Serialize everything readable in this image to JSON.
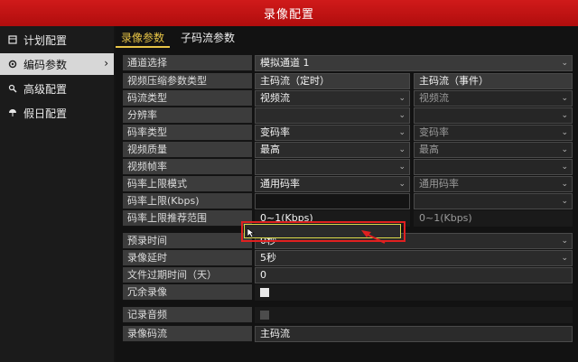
{
  "window": {
    "title": "录像配置"
  },
  "sidebar": {
    "items": [
      {
        "label": "计划配置",
        "icon": "calendar-icon"
      },
      {
        "label": "编码参数",
        "icon": "gear-icon",
        "active": true
      },
      {
        "label": "高级配置",
        "icon": "wrench-icon"
      },
      {
        "label": "假日配置",
        "icon": "umbrella-icon"
      }
    ]
  },
  "tabs": [
    {
      "label": "录像参数",
      "active": true
    },
    {
      "label": "子码流参数"
    }
  ],
  "form": {
    "channel": {
      "label": "通道选择",
      "value": "模拟通道 1"
    },
    "compression_type": {
      "label": "视频压缩参数类型",
      "main": "主码流（定时）",
      "event": "主码流（事件）"
    },
    "stream_type": {
      "label": "码流类型",
      "main": "视频流",
      "event": "视频流"
    },
    "resolution": {
      "label": "分辨率",
      "main": "",
      "event": ""
    },
    "bitrate_type": {
      "label": "码率类型",
      "main": "变码率",
      "event": "变码率"
    },
    "video_quality": {
      "label": "视频质量",
      "main": "最高",
      "event": "最高"
    },
    "frame_rate": {
      "label": "视频帧率",
      "main": "",
      "event": ""
    },
    "bitrate_limit_mode": {
      "label": "码率上限模式",
      "main": "通用码率",
      "event": "通用码率"
    },
    "bitrate_limit": {
      "label": "码率上限(Kbps)",
      "main": "",
      "event": ""
    },
    "bitrate_recommended": {
      "label": "码率上限推荐范围",
      "main": "0~1(Kbps)",
      "event": "0~1(Kbps)"
    },
    "pre_record": {
      "label": "预录时间",
      "value": "0秒"
    },
    "post_record": {
      "label": "录像延时",
      "value": "5秒"
    },
    "expire_days": {
      "label": "文件过期时间（天）",
      "value": "0"
    },
    "redundant": {
      "label": "冗余录像"
    },
    "audio": {
      "label": "记录音频"
    },
    "record_stream": {
      "label": "录像码流",
      "value": "主码流"
    }
  },
  "colors": {
    "titlebar": "#c41212",
    "accent": "#e8c547",
    "annotation": "#e02020"
  }
}
